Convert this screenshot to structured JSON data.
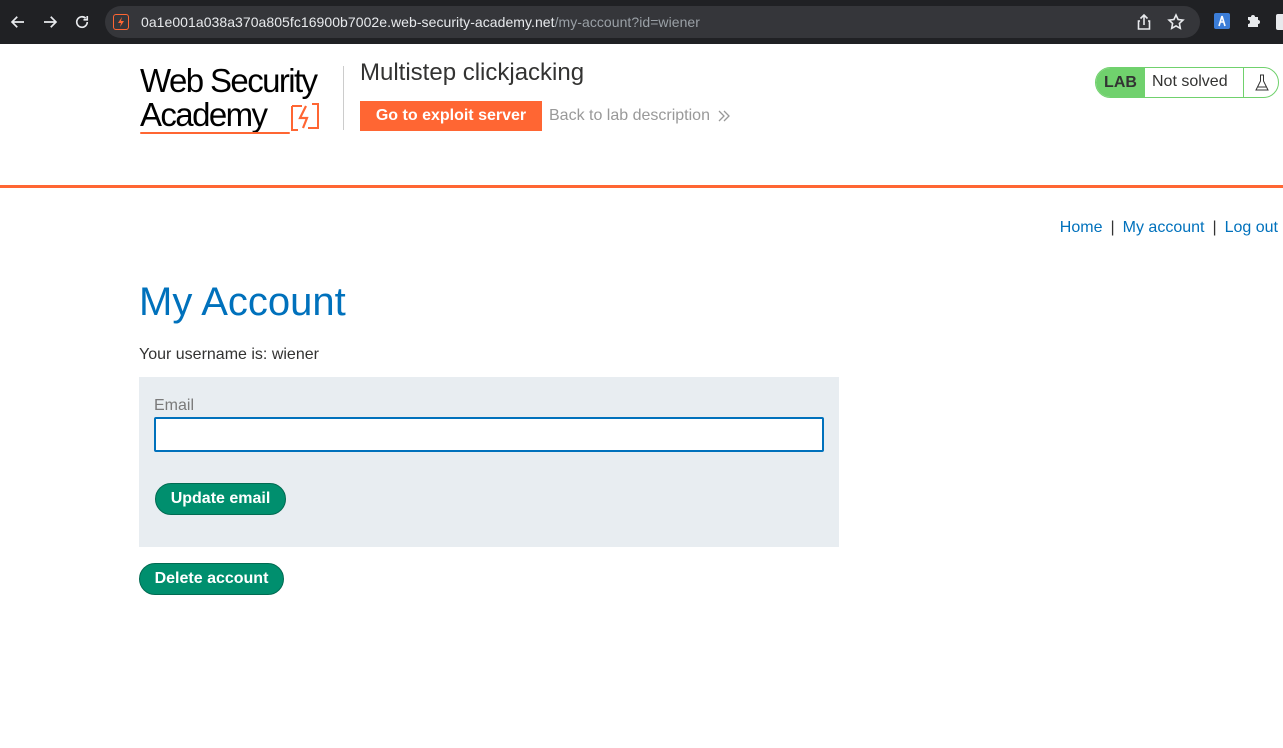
{
  "browser": {
    "url_host": "0a1e001a038a370a805fc16900b7002e.web-security-academy.net",
    "url_path": "/my-account?id=wiener",
    "icons": [
      "back-icon",
      "forward-icon",
      "reload-icon",
      "share-icon",
      "bookmark-star-icon",
      "extension-icon",
      "puzzle-icon"
    ]
  },
  "header": {
    "logo_line1": "Web Security",
    "logo_line2": "Academy",
    "lab_title": "Multistep clickjacking",
    "exploit_button": "Go to exploit server",
    "back_link": "Back to lab description",
    "status_badge": "LAB",
    "status_text": "Not solved",
    "accent_color": "#ff6633",
    "status_color": "#70d16d"
  },
  "nav": {
    "home": "Home",
    "separator": "|",
    "my_account": "My account",
    "log_out": "Log out"
  },
  "main": {
    "title": "My Account",
    "username_line": "Your username is: wiener",
    "email_label": "Email",
    "email_value": "",
    "update_button": "Update email",
    "delete_button": "Delete account"
  }
}
